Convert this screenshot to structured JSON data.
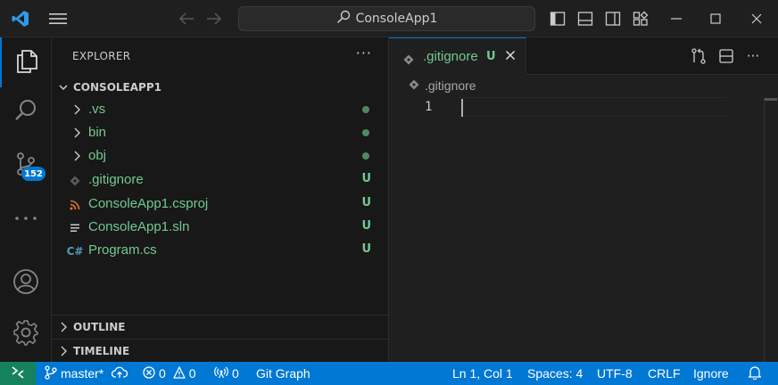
{
  "titlebar": {
    "search_text": "ConsoleApp1"
  },
  "activity": {
    "scm_badge": "152"
  },
  "explorer": {
    "header": "EXPLORER",
    "more": "···",
    "folder": "CONSOLEAPP1",
    "items": [
      {
        "label": ".vs",
        "type": "folder",
        "status": "dot"
      },
      {
        "label": "bin",
        "type": "folder",
        "status": "dot"
      },
      {
        "label": "obj",
        "type": "folder",
        "status": "dot"
      },
      {
        "label": ".gitignore",
        "type": "git-file",
        "status": "U"
      },
      {
        "label": "ConsoleApp1.csproj",
        "type": "rss-file",
        "status": "U"
      },
      {
        "label": "ConsoleApp1.sln",
        "type": "text-file",
        "status": "U"
      },
      {
        "label": "Program.cs",
        "type": "csharp-file",
        "status": "U"
      }
    ],
    "sections": {
      "outline": "OUTLINE",
      "timeline": "TIMELINE"
    }
  },
  "editor": {
    "tab_label": ".gitignore",
    "tab_status": "U",
    "breadcrumb": ".gitignore",
    "line_number": "1",
    "more": "···"
  },
  "statusbar": {
    "branch": "master*",
    "errors": "0",
    "warnings": "0",
    "ports": "0",
    "git_graph": "Git Graph",
    "position": "Ln 1, Col 1",
    "spaces": "Spaces: 4",
    "encoding": "UTF-8",
    "eol": "CRLF",
    "language": "Ignore"
  },
  "colors": {
    "accent": "#0078d4",
    "untracked": "#73c991",
    "remote": "#16825d"
  }
}
